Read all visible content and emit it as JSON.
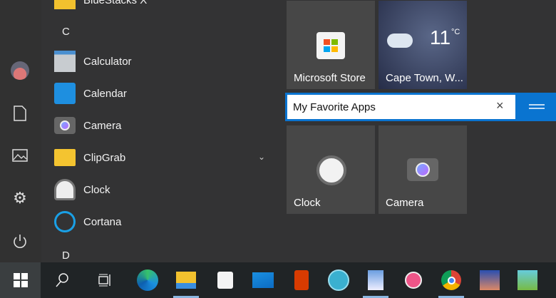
{
  "app_list": {
    "partial_top": "BlueStacks X",
    "sections": [
      {
        "letter": "C"
      },
      {
        "letter": "D"
      }
    ],
    "items": [
      {
        "label": "Calculator"
      },
      {
        "label": "Calendar"
      },
      {
        "label": "Camera"
      },
      {
        "label": "ClipGrab"
      },
      {
        "label": "Clock"
      },
      {
        "label": "Cortana"
      }
    ]
  },
  "tiles": {
    "store": {
      "label": "Microsoft Store"
    },
    "weather": {
      "label": "Cape Town, W...",
      "temp": "11",
      "unit": "°C"
    },
    "group": {
      "name": "My Favorite Apps",
      "clear": "×"
    },
    "clock": {
      "label": "Clock"
    },
    "camera": {
      "label": "Camera"
    }
  },
  "colors": {
    "accent": "#0a74d0",
    "background": "#333334",
    "taskbar": "#202426"
  }
}
